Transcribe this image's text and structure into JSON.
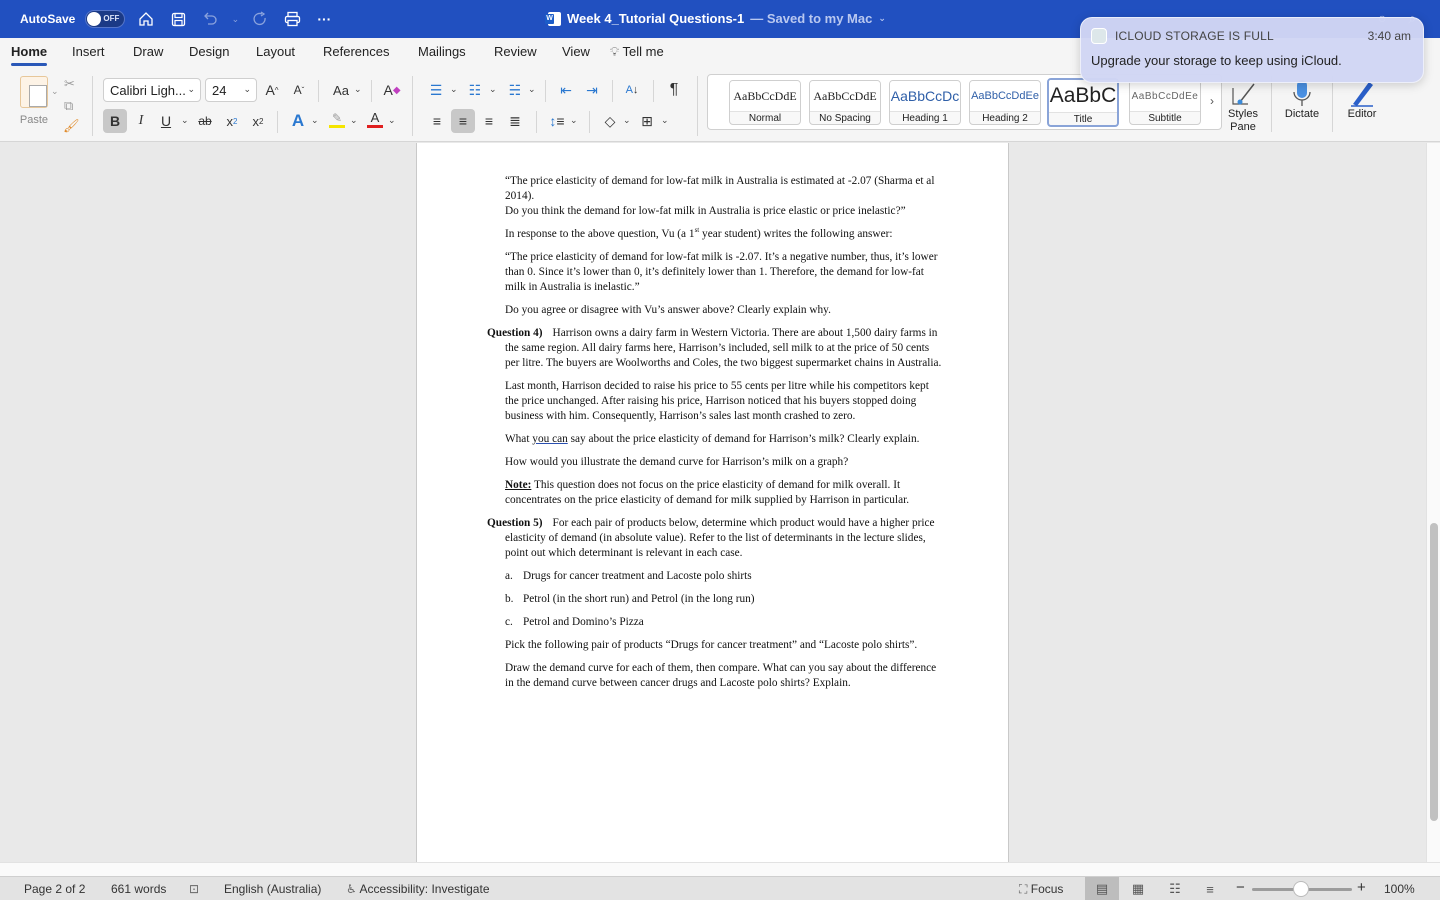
{
  "titlebar": {
    "autosave_label": "AutoSave",
    "autosave_state": "OFF",
    "doc_title": "Week 4_Tutorial Questions-1",
    "saved_status": "— Saved to my Mac",
    "icons": [
      "home-icon",
      "save-icon",
      "undo-icon",
      "redo-icon",
      "print-icon",
      "more-icon"
    ]
  },
  "tabs": [
    {
      "label": "Home",
      "active": true
    },
    {
      "label": "Insert"
    },
    {
      "label": "Draw"
    },
    {
      "label": "Design"
    },
    {
      "label": "Layout"
    },
    {
      "label": "References"
    },
    {
      "label": "Mailings"
    },
    {
      "label": "Review"
    },
    {
      "label": "View"
    },
    {
      "label": "Tell me"
    }
  ],
  "ribbon": {
    "paste_label": "Paste",
    "font_name": "Calibri Ligh...",
    "font_size": "24",
    "case_label": "Aa",
    "styles": [
      {
        "sample": "AaBbCcDdE",
        "name": "Normal"
      },
      {
        "sample": "AaBbCcDdE",
        "name": "No Spacing"
      },
      {
        "sample": "AaBbCcDc",
        "name": "Heading 1"
      },
      {
        "sample": "AaBbCcDdEe",
        "name": "Heading 2"
      },
      {
        "sample": "AaBbC",
        "name": "Title",
        "active": true
      },
      {
        "sample": "AaBbCcDdEe",
        "name": "Subtitle"
      }
    ],
    "styles_pane_label": "Styles Pane",
    "dictate_label": "Dictate",
    "editor_label": "Editor",
    "colors": {
      "highlight": "#f5e500",
      "font_color": "#e02020",
      "accent": "#2150c0"
    }
  },
  "document": {
    "p1": "“The price elasticity of demand for low-fat milk in Australia is estimated at -2.07 (Sharma et al 2014).",
    "p1b": "Do you think the demand for low-fat milk in Australia is price elastic or price inelastic?”",
    "p2_pre": "In response to the above question, Vu (a 1",
    "p2_sup": "st",
    "p2_post": " year student) writes the following answer:",
    "p3": "“The price elasticity of demand for low-fat milk is -2.07. It’s a negative number, thus, it’s lower than 0. Since it’s lower than 0, it’s definitely lower than 1. Therefore, the demand for low-fat milk in Australia is inelastic.”",
    "p4": "Do you agree or disagree with Vu’s answer above? Clearly explain why.",
    "q4_label": "Question 4)",
    "q4_text": "Harrison owns a dairy farm in Western Victoria. There are about 1,500 dairy farms in the same region. All dairy farms here, Harrison’s included, sell milk to at the price of 50 cents per litre. The buyers are Woolworths and Coles, the two biggest supermarket chains in Australia.",
    "q4_p2": "Last month, Harrison decided to raise his price to 55 cents per litre while his competitors kept the price unchanged. After raising his price, Harrison noticed that his buyers stopped doing business with him. Consequently, Harrison’s sales last month crashed to zero.",
    "q4_p3_pre": "What ",
    "q4_p3_ul": "you can",
    "q4_p3_post": " say about the price elasticity of demand for Harrison’s milk? Clearly explain.",
    "q4_p4": "How would you illustrate the demand curve for Harrison’s milk on a graph?",
    "note_label": "Note:",
    "note_text": " This question does not focus on the price elasticity of demand for milk overall. It concentrates on the price elasticity of demand for milk supplied by Harrison in particular.",
    "q5_label": "Question 5)",
    "q5_text": "For each pair of products below, determine which product would have a higher price elasticity of demand (in absolute value). Refer to the list of determinants in the lecture slides, point out which determinant is relevant in each case.",
    "list": [
      {
        "marker": "a.",
        "text": "Drugs for cancer treatment and Lacoste polo shirts"
      },
      {
        "marker": "b.",
        "text": "Petrol (in the short run) and Petrol (in the long run)"
      },
      {
        "marker": "c.",
        "text": "Petrol and Domino’s Pizza"
      }
    ],
    "q5_p2": "Pick the following pair of products “Drugs for cancer treatment” and “Lacoste polo shirts”.",
    "q5_p3": "Draw the demand curve for each of them, then compare. What can you say about the difference in the demand curve between cancer drugs and Lacoste polo shirts? Explain."
  },
  "statusbar": {
    "page": "Page 2 of 2",
    "words": "661 words",
    "language": "English (Australia)",
    "accessibility": "Accessibility: Investigate",
    "focus": "Focus",
    "zoom": "100%",
    "zoom_percent": 100
  },
  "notification": {
    "title": "ICLOUD STORAGE IS FULL",
    "time": "3:40 am",
    "body": "Upgrade your storage to keep using iCloud."
  }
}
